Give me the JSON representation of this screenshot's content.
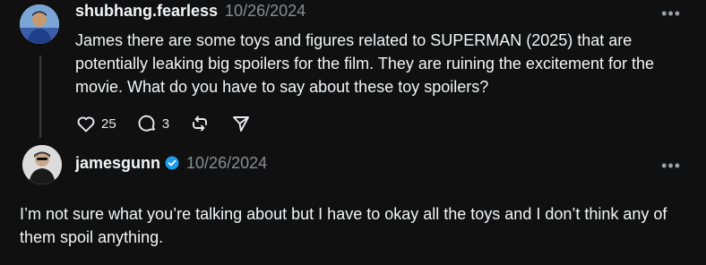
{
  "posts": [
    {
      "username": "shubhang.fearless",
      "timestamp": "10/26/2024",
      "text": "James there are some toys and figures related to SUPERMAN (2025) that are potentially leaking big spoilers for the film. They are ruining the excitement for the movie. What do you have to say about these toy spoilers?",
      "more_label": "•••",
      "likes": "25",
      "replies": "3"
    },
    {
      "username": "jamesgunn",
      "timestamp": "10/26/2024",
      "verified": true,
      "text": "I’m not sure what you’re talking about but I have to okay all the toys and I don’t think any of them spoil anything.",
      "more_label": "•••"
    }
  ],
  "icons": {
    "like": "heart-icon",
    "reply": "comment-icon",
    "repost": "repost-icon",
    "share": "send-icon",
    "verified": "verified-badge-icon"
  },
  "colors": {
    "background": "#101010",
    "text": "#f3f5f7",
    "muted": "#8a8d91",
    "verified": "#1d9bf0"
  }
}
